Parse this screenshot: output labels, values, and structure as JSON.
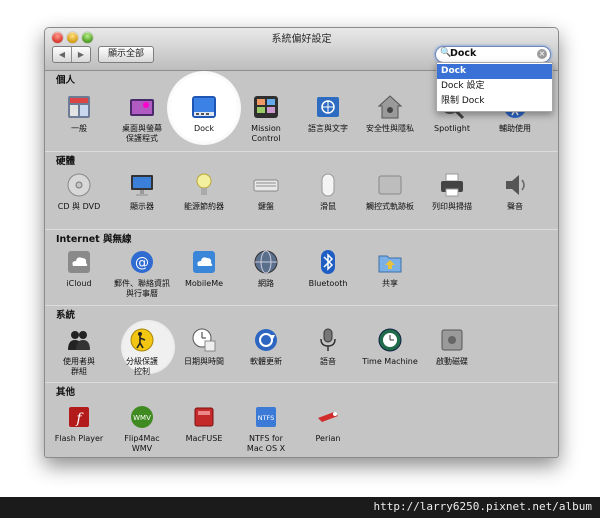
{
  "window": {
    "title": "系統偏好設定"
  },
  "toolbar": {
    "back_label": "◀",
    "forward_label": "▶",
    "show_all_label": "顯示全部"
  },
  "search": {
    "value": "Dock",
    "glass": "🔍",
    "clear": "×"
  },
  "dropdown": {
    "items": [
      "Dock",
      "Dock 設定",
      "限制 Dock"
    ]
  },
  "sections": {
    "personal": {
      "title": "個人",
      "items": [
        "一般",
        "桌面與螢幕\n保護程式",
        "Dock",
        "Mission\nControl",
        "語言與文字",
        "安全性與隱私",
        "Spotlight",
        "輔助使用"
      ]
    },
    "hardware": {
      "title": "硬體",
      "items": [
        "CD 與 DVD",
        "顯示器",
        "能源節約器",
        "鍵盤",
        "滑鼠",
        "觸控式軌跡板",
        "列印與掃描",
        "聲音"
      ]
    },
    "internet": {
      "title": "Internet 與無線",
      "items": [
        "iCloud",
        "郵件、聯絡資訊\n與行事曆",
        "MobileMe",
        "網路",
        "Bluetooth",
        "共享"
      ]
    },
    "system": {
      "title": "系統",
      "items": [
        "使用者與\n群組",
        "分級保護\n控制",
        "日期與時間",
        "軟體更新",
        "語音",
        "Time Machine",
        "啟動磁碟"
      ]
    },
    "other": {
      "title": "其他",
      "items": [
        "Flash Player",
        "Flip4Mac\nWMV",
        "MacFUSE",
        "NTFS for\nMac OS X",
        "Perian"
      ]
    }
  },
  "footer": {
    "url": "http://larry6250.pixnet.net/album"
  },
  "colors": {
    "highlight_blue": "#3a71d6",
    "window_bg": "#c5c5c5",
    "footer_bg": "#1b1b1b"
  }
}
